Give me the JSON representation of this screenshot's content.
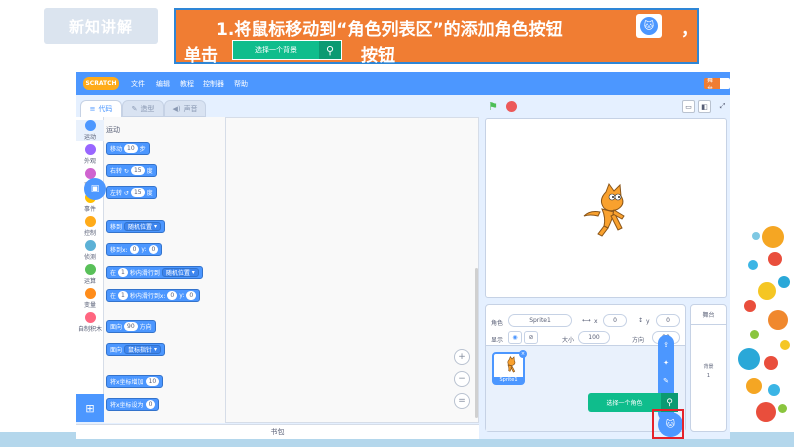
{
  "slide": {
    "badge": "新知讲解",
    "instruction_line1": "1.将鼠标移动到“角色列表区”的添加角色按钮",
    "instruction_comma": "，",
    "instruction_line2_start": "单击",
    "instruction_button_label": "选择一个背景",
    "instruction_line2_end": "按钮"
  },
  "scratch": {
    "logo": "SCRATCH",
    "menu": [
      "文件",
      "编辑",
      "教程",
      "控制器",
      "帮助"
    ],
    "stage_toggle": "舞台",
    "tabs": {
      "code": "代码",
      "costumes": "造型",
      "sounds": "声音"
    },
    "categories": [
      {
        "label": "运动",
        "color": "#4c97ff"
      },
      {
        "label": "外观",
        "color": "#9966ff"
      },
      {
        "label": "声音",
        "color": "#cf63cf"
      },
      {
        "label": "事件",
        "color": "#ffbf00"
      },
      {
        "label": "控制",
        "color": "#ffab19"
      },
      {
        "label": "侦测",
        "color": "#5cb1d6"
      },
      {
        "label": "运算",
        "color": "#59c059"
      },
      {
        "label": "变量",
        "color": "#ff8c1a"
      },
      {
        "label": "自制积木",
        "color": "#ff6680"
      }
    ],
    "palette_heading": "运动",
    "blocks": {
      "move": {
        "text": "移动",
        "value": "10",
        "suffix": "步"
      },
      "turn_right": {
        "text": "右转 ↻",
        "value": "15",
        "suffix": "度"
      },
      "turn_left": {
        "text": "左转 ↺",
        "value": "15",
        "suffix": "度"
      },
      "goto": {
        "text": "移到",
        "dropdown": "随机位置"
      },
      "goto_xy": {
        "text": "移到x:",
        "x": "0",
        "ylabel": "y:",
        "y": "0"
      },
      "glide": {
        "text": "在",
        "secs": "1",
        "mid": "秒内滑行到",
        "dropdown": "随机位置"
      },
      "glide_xy": {
        "text": "在",
        "secs": "1",
        "mid": "秒内滑行到x:",
        "x": "0",
        "ylabel": "y:",
        "y": "0"
      },
      "point_dir": {
        "text": "面向",
        "value": "90",
        "suffix": "方向"
      },
      "point_towards": {
        "text": "面向",
        "dropdown": "鼠标指针"
      },
      "change_x": {
        "text": "将x坐标增加",
        "value": "10"
      },
      "set_x": {
        "text": "将x坐标设为",
        "value": "0"
      }
    },
    "backpack": "书包",
    "sprite_info": {
      "sprite_label": "角色",
      "sprite_name": "Sprite1",
      "x_label": "x",
      "x_value": "0",
      "y_label": "y",
      "y_value": "0",
      "show_label": "显示",
      "size_label": "大小",
      "size_value": "100",
      "direction_label": "方向",
      "direction_value": "90"
    },
    "sprite_thumb_name": "Sprite1",
    "stage_pane": {
      "header": "舞台",
      "backdrops_label": "背景",
      "backdrops_count": "1"
    },
    "choose_sprite_label": "选择一个角色"
  }
}
